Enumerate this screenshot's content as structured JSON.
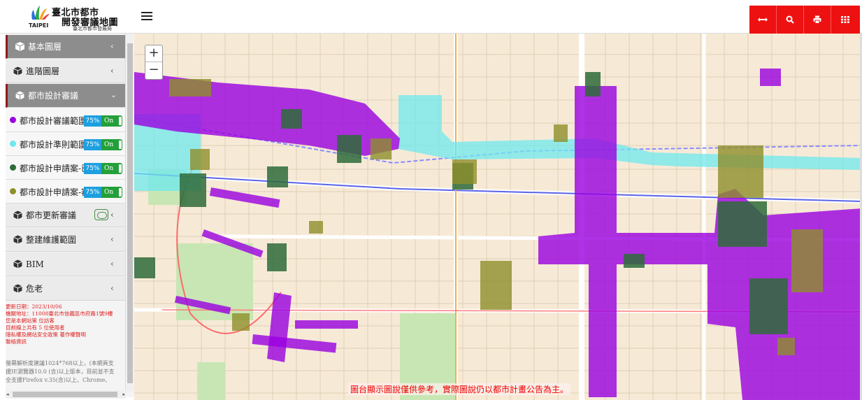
{
  "header": {
    "title_line1": "臺北市都市",
    "title_line2": "開發審議地圖",
    "subtitle": "臺北市都市發展局",
    "logo_text": "TAIPEI"
  },
  "toolbar": {
    "icons": [
      "resize-arrows-icon",
      "search-icon",
      "print-icon",
      "grid-icon"
    ]
  },
  "sidebar": {
    "categories": [
      {
        "label": "基本圖層",
        "active": true
      },
      {
        "label": "進階圖層",
        "active": false
      },
      {
        "label": "都市設計審議",
        "active": true,
        "expanded": true
      },
      {
        "label": "都市更新審議",
        "active": false
      },
      {
        "label": "整建維護範圍",
        "active": false
      },
      {
        "label": "BIM",
        "active": false
      },
      {
        "label": "危老",
        "active": false
      }
    ],
    "layers": [
      {
        "name": "都市設計審議範圍圖",
        "color": "#9a00e0",
        "opacity": "75%",
        "state": "On"
      },
      {
        "name": "都市設計準則範圍圖",
        "color": "#6fe8ee",
        "opacity": "75%",
        "state": "On"
      },
      {
        "name": "都市設計申請案-已",
        "color": "#2e6b3a",
        "opacity": "75%",
        "state": "On"
      },
      {
        "name": "都市設計申請案-審",
        "color": "#8f8f2a",
        "opacity": "75%",
        "state": "On"
      }
    ],
    "info_lines": [
      "更新日期：2023/10/06",
      "機關地址：11008臺北市信義區市府路1號9樓",
      "您是本網站第 位訪客",
      "目前線上共有 5 位使用者",
      "隱私權及網站安全政策 著作權聲明",
      "聯絡資訊"
    ],
    "note_lines": [
      "螢幕解析度建議1024*768以上，(本網頁支",
      "援IE瀏覽器10.0 (含)以上版本，目前並不支",
      "全支援Firefox v.35(含)以上、Chrome、"
    ]
  },
  "map": {
    "disclaimer": "圖台顯示圖說僅供參考，實際圖說仍以都市計畫公告為主。",
    "zoom_in": "+",
    "zoom_out": "−",
    "colors": {
      "base": "#f6ead7",
      "review_area": "#9a00e0",
      "guideline_area": "#6fe8ee",
      "case_done": "#2e6b3a",
      "case_review": "#8f8f2a",
      "park": "#c8e6b4"
    }
  }
}
